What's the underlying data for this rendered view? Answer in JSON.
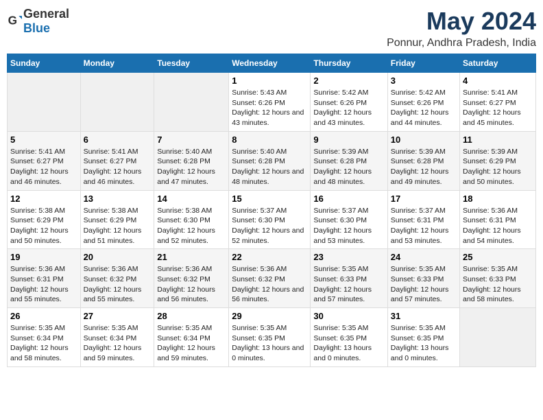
{
  "logo": {
    "general": "General",
    "blue": "Blue"
  },
  "title": "May 2024",
  "subtitle": "Ponnur, Andhra Pradesh, India",
  "weekdays": [
    "Sunday",
    "Monday",
    "Tuesday",
    "Wednesday",
    "Thursday",
    "Friday",
    "Saturday"
  ],
  "weeks": [
    [
      {
        "day": "",
        "empty": true
      },
      {
        "day": "",
        "empty": true
      },
      {
        "day": "",
        "empty": true
      },
      {
        "day": "1",
        "sunrise": "5:43 AM",
        "sunset": "6:26 PM",
        "daylight": "12 hours and 43 minutes."
      },
      {
        "day": "2",
        "sunrise": "5:42 AM",
        "sunset": "6:26 PM",
        "daylight": "12 hours and 43 minutes."
      },
      {
        "day": "3",
        "sunrise": "5:42 AM",
        "sunset": "6:26 PM",
        "daylight": "12 hours and 44 minutes."
      },
      {
        "day": "4",
        "sunrise": "5:41 AM",
        "sunset": "6:27 PM",
        "daylight": "12 hours and 45 minutes."
      }
    ],
    [
      {
        "day": "5",
        "sunrise": "5:41 AM",
        "sunset": "6:27 PM",
        "daylight": "12 hours and 46 minutes."
      },
      {
        "day": "6",
        "sunrise": "5:41 AM",
        "sunset": "6:27 PM",
        "daylight": "12 hours and 46 minutes."
      },
      {
        "day": "7",
        "sunrise": "5:40 AM",
        "sunset": "6:28 PM",
        "daylight": "12 hours and 47 minutes."
      },
      {
        "day": "8",
        "sunrise": "5:40 AM",
        "sunset": "6:28 PM",
        "daylight": "12 hours and 48 minutes."
      },
      {
        "day": "9",
        "sunrise": "5:39 AM",
        "sunset": "6:28 PM",
        "daylight": "12 hours and 48 minutes."
      },
      {
        "day": "10",
        "sunrise": "5:39 AM",
        "sunset": "6:28 PM",
        "daylight": "12 hours and 49 minutes."
      },
      {
        "day": "11",
        "sunrise": "5:39 AM",
        "sunset": "6:29 PM",
        "daylight": "12 hours and 50 minutes."
      }
    ],
    [
      {
        "day": "12",
        "sunrise": "5:38 AM",
        "sunset": "6:29 PM",
        "daylight": "12 hours and 50 minutes."
      },
      {
        "day": "13",
        "sunrise": "5:38 AM",
        "sunset": "6:29 PM",
        "daylight": "12 hours and 51 minutes."
      },
      {
        "day": "14",
        "sunrise": "5:38 AM",
        "sunset": "6:30 PM",
        "daylight": "12 hours and 52 minutes."
      },
      {
        "day": "15",
        "sunrise": "5:37 AM",
        "sunset": "6:30 PM",
        "daylight": "12 hours and 52 minutes."
      },
      {
        "day": "16",
        "sunrise": "5:37 AM",
        "sunset": "6:30 PM",
        "daylight": "12 hours and 53 minutes."
      },
      {
        "day": "17",
        "sunrise": "5:37 AM",
        "sunset": "6:31 PM",
        "daylight": "12 hours and 53 minutes."
      },
      {
        "day": "18",
        "sunrise": "5:36 AM",
        "sunset": "6:31 PM",
        "daylight": "12 hours and 54 minutes."
      }
    ],
    [
      {
        "day": "19",
        "sunrise": "5:36 AM",
        "sunset": "6:31 PM",
        "daylight": "12 hours and 55 minutes."
      },
      {
        "day": "20",
        "sunrise": "5:36 AM",
        "sunset": "6:32 PM",
        "daylight": "12 hours and 55 minutes."
      },
      {
        "day": "21",
        "sunrise": "5:36 AM",
        "sunset": "6:32 PM",
        "daylight": "12 hours and 56 minutes."
      },
      {
        "day": "22",
        "sunrise": "5:36 AM",
        "sunset": "6:32 PM",
        "daylight": "12 hours and 56 minutes."
      },
      {
        "day": "23",
        "sunrise": "5:35 AM",
        "sunset": "6:33 PM",
        "daylight": "12 hours and 57 minutes."
      },
      {
        "day": "24",
        "sunrise": "5:35 AM",
        "sunset": "6:33 PM",
        "daylight": "12 hours and 57 minutes."
      },
      {
        "day": "25",
        "sunrise": "5:35 AM",
        "sunset": "6:33 PM",
        "daylight": "12 hours and 58 minutes."
      }
    ],
    [
      {
        "day": "26",
        "sunrise": "5:35 AM",
        "sunset": "6:34 PM",
        "daylight": "12 hours and 58 minutes."
      },
      {
        "day": "27",
        "sunrise": "5:35 AM",
        "sunset": "6:34 PM",
        "daylight": "12 hours and 59 minutes."
      },
      {
        "day": "28",
        "sunrise": "5:35 AM",
        "sunset": "6:34 PM",
        "daylight": "12 hours and 59 minutes."
      },
      {
        "day": "29",
        "sunrise": "5:35 AM",
        "sunset": "6:35 PM",
        "daylight": "13 hours and 0 minutes."
      },
      {
        "day": "30",
        "sunrise": "5:35 AM",
        "sunset": "6:35 PM",
        "daylight": "13 hours and 0 minutes."
      },
      {
        "day": "31",
        "sunrise": "5:35 AM",
        "sunset": "6:35 PM",
        "daylight": "13 hours and 0 minutes."
      },
      {
        "day": "",
        "empty": true
      }
    ]
  ],
  "colors": {
    "header_bg": "#1a6faf",
    "alt_row": "#f5f5f5",
    "empty_cell": "#efefef"
  }
}
